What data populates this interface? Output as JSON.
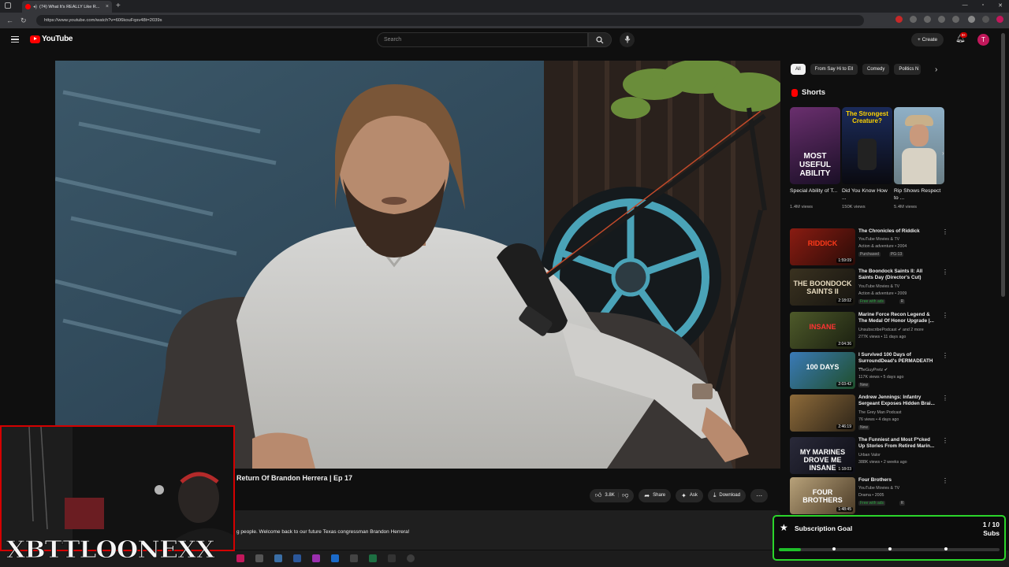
{
  "browser": {
    "tab_title": "(74) What It's REALLY Like R...",
    "url": "https://www.youtube.com/watch?v=606kouFqsv48t=2039s"
  },
  "header": {
    "logo_text": "YouTube",
    "search_placeholder": "Search",
    "create_label": "Create",
    "notification_badge": "9+",
    "avatar_letter": "T"
  },
  "video": {
    "title": "Return Of Brandon Herrera | Ep 17",
    "likes": "3.8K",
    "share_label": "Share",
    "ask_label": "Ask",
    "download_label": "Download",
    "description": "g people. Welcome back to our future Texas congressman Brandon Herrera!"
  },
  "sidebar": {
    "chips": [
      "All",
      "From Say Hi to Ell",
      "Comedy",
      "Politics N"
    ],
    "shorts_heading": "Shorts",
    "shorts": [
      {
        "title": "Special Ability of T...",
        "views": "1.4M views",
        "thumb_text": "MOST USEFUL ABILITY"
      },
      {
        "title": "Did You Know How ...",
        "views": "150K views",
        "thumb_text": "The Strongest Creature?"
      },
      {
        "title": "Rip Shows Respect to ...",
        "views": "5.4M views",
        "thumb_text": ""
      }
    ],
    "recommendations": [
      {
        "title": "The Chronicles of Riddick",
        "channel": "YouTube Movies & TV",
        "meta": "Action & adventure • 2004",
        "tags": [
          "Purchased",
          "PG-13"
        ],
        "duration": "1:59:09",
        "thumb_text": "RIDDICK"
      },
      {
        "title": "The Boondock Saints II: All Saints Day (Director's Cut)",
        "channel": "YouTube Movies & TV",
        "meta": "Action & adventure • 2009",
        "tags": [
          "Free with ads",
          "R"
        ],
        "duration": "2:18:02",
        "thumb_text": "THE BOONDOCK SAINTS II"
      },
      {
        "title": "Marine Force Recon Legend & The Medal Of Honor Upgrade |...",
        "channel": "UnsubscribePodcast ✔ and 2 more",
        "meta": "277K views • 11 days ago",
        "tags": [],
        "duration": "2:04:36",
        "thumb_text": "INSANE"
      },
      {
        "title": "I Survived 100 Days of SurroundDead's PERMADEATH ...",
        "channel": "TheGuyPretz ✔",
        "meta": "117K views • 5 days ago",
        "tags": [
          "New"
        ],
        "duration": "2:03:42",
        "thumb_text": "100 DAYS"
      },
      {
        "title": "Andrew Jennings: Infantry Sergeant Exposes Hidden Brai...",
        "channel": "The Grey Man Podcast",
        "meta": "76 views • 4 days ago",
        "tags": [
          "New"
        ],
        "duration": "2:46:19",
        "thumb_text": ""
      },
      {
        "title": "The Funniest and Most F*cked Up Stories From Retired Marin...",
        "channel": "Urban Valor",
        "meta": "388K views • 2 weeks ago",
        "tags": [],
        "duration": "1:18:03",
        "thumb_text": "MY MARINES DROVE ME INSANE"
      },
      {
        "title": "Four Brothers",
        "channel": "YouTube Movies & TV",
        "meta": "Drama • 2005",
        "tags": [
          "Free with ads",
          "R"
        ],
        "duration": "1:48:45",
        "thumb_text": "FOUR BROTHERS"
      }
    ]
  },
  "overlay": {
    "streamer_name": "XBTTLOONEXX",
    "goal_title": "Subscription Goal",
    "goal_count": "1 / 10",
    "goal_unit": "Subs",
    "goal_progress": 0.1
  },
  "colors": {
    "brand": "#ff0000",
    "goal_border": "#2bd52b",
    "cam_border": "#d40000"
  }
}
